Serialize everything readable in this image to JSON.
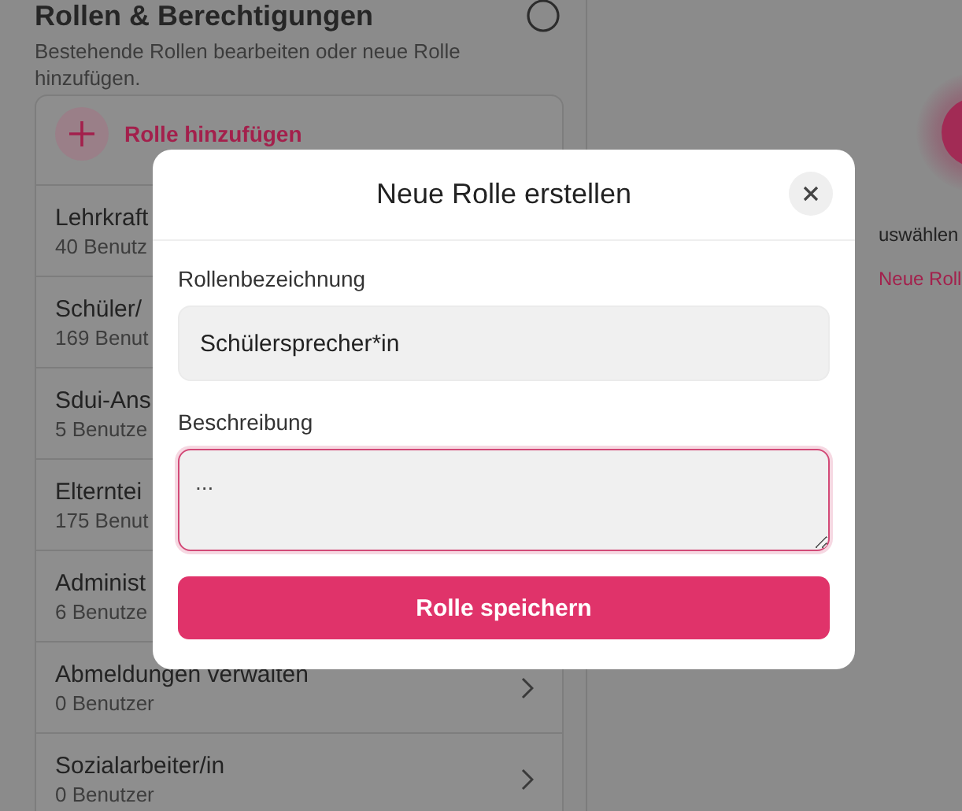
{
  "page": {
    "title": "Rollen & Berechtigungen",
    "subtitle": "Bestehende Rollen bearbeiten oder neue Rolle hinzufügen.",
    "add_role": "Rolle hinzufügen",
    "roles": [
      {
        "name": "Lehrkraft",
        "users": "40 Benutz"
      },
      {
        "name": "Schüler/",
        "users": "169 Benut"
      },
      {
        "name": "Sdui-Ans",
        "users": "5 Benutze"
      },
      {
        "name": "Elterntei",
        "users": "175 Benut"
      },
      {
        "name": "Administ",
        "users": "6 Benutze"
      },
      {
        "name": "Abmeldungen verwalten",
        "users": "0 Benutzer",
        "chevron": true
      },
      {
        "name": "Sozialarbeiter/in",
        "users": "0 Benutzer",
        "chevron": true
      }
    ],
    "detail_hint": "uswählen",
    "detail_link": "Neue Roll"
  },
  "dialog": {
    "title": "Neue Rolle erstellen",
    "name_label": "Rollenbezeichnung",
    "name_value": "Schülersprecher*in",
    "description_label": "Beschreibung",
    "description_value": "...",
    "description_focused": true,
    "save": "Rolle speichern"
  }
}
